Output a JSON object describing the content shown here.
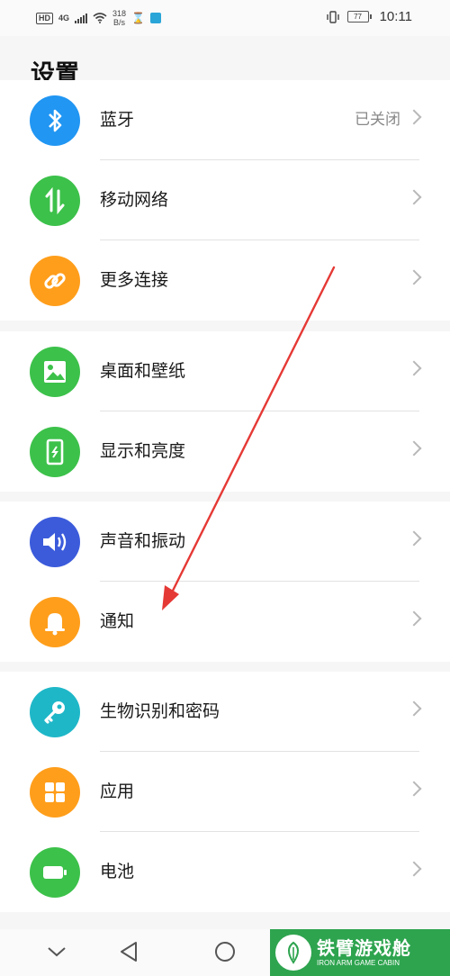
{
  "status_bar": {
    "hd": "HD",
    "network": "4G",
    "speed_top": "318",
    "speed_bottom": "B/s",
    "battery": "77",
    "time": "10:11"
  },
  "page_title": "设置",
  "groups": [
    {
      "items": [
        {
          "label": "蓝牙",
          "value": "已关闭",
          "icon": "bluetooth-icon",
          "color": "#2196f3"
        },
        {
          "label": "移动网络",
          "value": "",
          "icon": "mobile-data-icon",
          "color": "#3cc14a"
        },
        {
          "label": "更多连接",
          "value": "",
          "icon": "link-icon",
          "color": "#ff9e1b"
        }
      ]
    },
    {
      "items": [
        {
          "label": "桌面和壁纸",
          "value": "",
          "icon": "image-icon",
          "color": "#3cc14a"
        },
        {
          "label": "显示和亮度",
          "value": "",
          "icon": "phone-brightness-icon",
          "color": "#3cc14a"
        }
      ]
    },
    {
      "items": [
        {
          "label": "声音和振动",
          "value": "",
          "icon": "speaker-icon",
          "color": "#3b5bdb"
        },
        {
          "label": "通知",
          "value": "",
          "icon": "bell-icon",
          "color": "#ff9e1b"
        }
      ]
    },
    {
      "items": [
        {
          "label": "生物识别和密码",
          "value": "",
          "icon": "key-icon",
          "color": "#1eb7c8"
        },
        {
          "label": "应用",
          "value": "",
          "icon": "apps-grid-icon",
          "color": "#ff9e1b"
        },
        {
          "label": "电池",
          "value": "",
          "icon": "battery-icon",
          "color": "#3cc14a"
        }
      ]
    }
  ],
  "watermark": {
    "title": "铁臂游戏舱",
    "subtitle": "IRON ARM GAME CABIN",
    "color": "#2ea44f"
  },
  "annotation": {
    "color": "#e53935"
  }
}
